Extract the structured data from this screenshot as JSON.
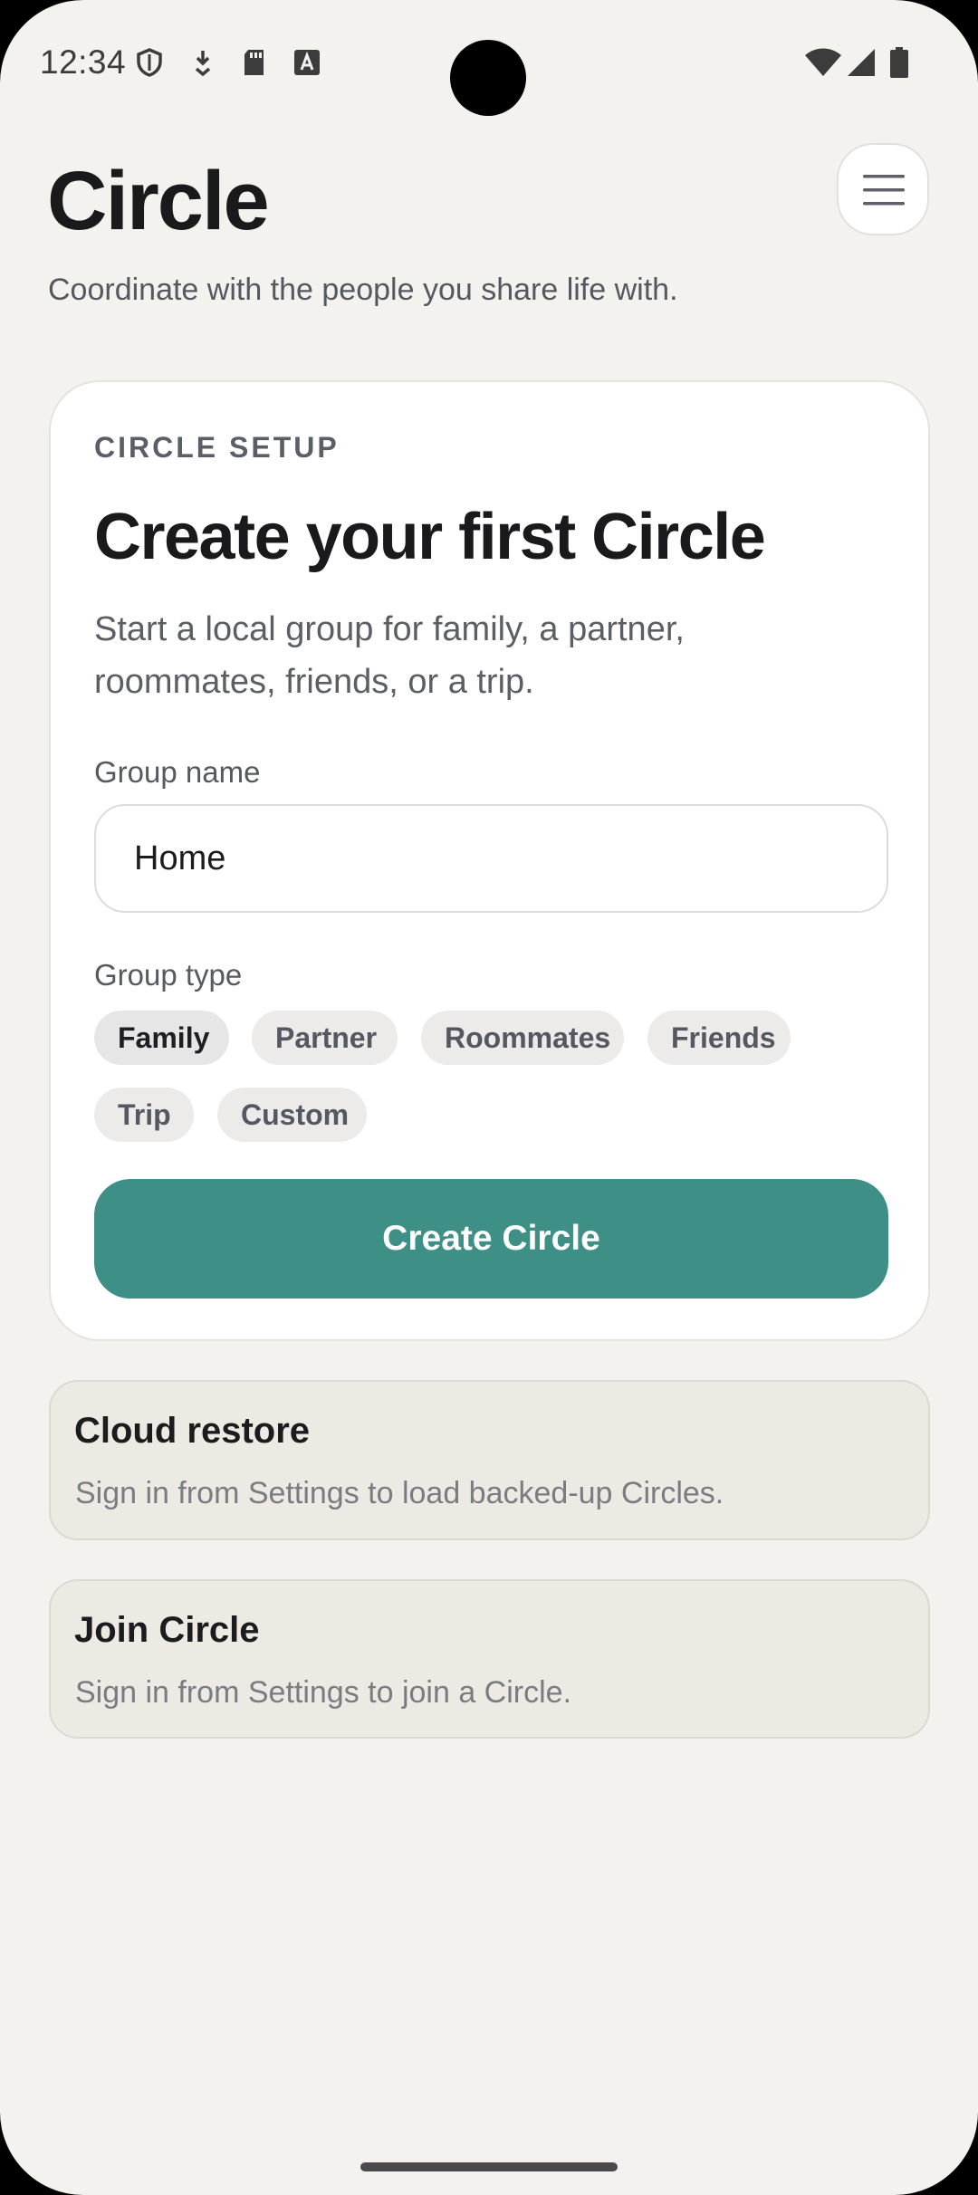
{
  "status_bar": {
    "time": "12:34",
    "left_icons": [
      "shield-icon",
      "download-arrow-icon",
      "sd-card-icon",
      "text-a-icon"
    ],
    "right_icons": [
      "wifi-icon",
      "cellular-signal-icon",
      "battery-icon"
    ]
  },
  "header": {
    "title": "Circle",
    "subtitle": "Coordinate with the people you share life with.",
    "menu_icon": "menu-icon"
  },
  "setup_card": {
    "eyebrow": "CIRCLE SETUP",
    "title": "Create your first Circle",
    "description": "Start a local group for family, a partner, roommates, friends, or a trip.",
    "group_name_label": "Group name",
    "group_name_value": "Home",
    "group_type_label": "Group type",
    "group_types": [
      "Family",
      "Partner",
      "Roommates",
      "Friends",
      "Trip",
      "Custom"
    ],
    "selected_group_type": "Family",
    "create_button_label": "Create Circle"
  },
  "cloud_restore": {
    "title": "Cloud restore",
    "text": "Sign in from Settings to load backed-up Circles."
  },
  "join_circle": {
    "title": "Join Circle",
    "text": "Sign in from Settings to join a Circle."
  },
  "colors": {
    "background": "#f4f2ee",
    "accent": "#3e8f86",
    "card": "#ffffff",
    "secondary_card": "#ede9e3"
  }
}
